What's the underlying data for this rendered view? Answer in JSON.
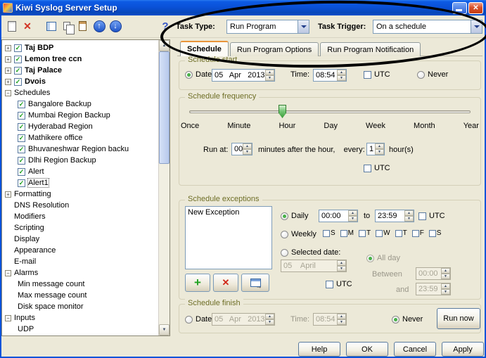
{
  "window": {
    "title": "Kiwi Syslog Server Setup"
  },
  "toolbar": {
    "task_type_label": "Task Type:",
    "task_type_value": "Run Program",
    "task_trigger_label": "Task Trigger:",
    "task_trigger_value": "On a schedule"
  },
  "tabs": [
    {
      "label": "Schedule",
      "active": true
    },
    {
      "label": "Run Program Options",
      "active": false
    },
    {
      "label": "Run Program Notification",
      "active": false
    }
  ],
  "tree": {
    "items": [
      {
        "label": "Taj BDP",
        "level": 0,
        "expander": "plus",
        "checkbox": true,
        "checked": true,
        "bold": true
      },
      {
        "label": "Lemon tree ccn",
        "level": 0,
        "expander": "plus",
        "checkbox": true,
        "checked": true,
        "bold": true
      },
      {
        "label": "Taj Palace",
        "level": 0,
        "expander": "plus",
        "checkbox": true,
        "checked": true,
        "bold": true
      },
      {
        "label": "Dvois",
        "level": 0,
        "expander": "plus",
        "checkbox": true,
        "checked": true,
        "bold": true
      },
      {
        "label": "Schedules",
        "level": 0,
        "expander": "minus"
      },
      {
        "label": "Bangalore Backup",
        "level": 1,
        "checkbox": true,
        "checked": true
      },
      {
        "label": "Mumbai Region Backup",
        "level": 1,
        "checkbox": true,
        "checked": true
      },
      {
        "label": "Hyderabad Region",
        "level": 1,
        "checkbox": true,
        "checked": true
      },
      {
        "label": "Mathikere office",
        "level": 1,
        "checkbox": true,
        "checked": true
      },
      {
        "label": "Bhuvaneshwar Region backu",
        "level": 1,
        "checkbox": true,
        "checked": true
      },
      {
        "label": "Dlhi Region Backup",
        "level": 1,
        "checkbox": true,
        "checked": true
      },
      {
        "label": "Alert",
        "level": 1,
        "checkbox": true,
        "checked": true
      },
      {
        "label": "Alert1",
        "level": 1,
        "checkbox": true,
        "checked": true,
        "selected": true
      },
      {
        "label": "Formatting",
        "level": 0,
        "expander": "plus"
      },
      {
        "label": "DNS Resolution",
        "level": 0
      },
      {
        "label": "Modifiers",
        "level": 0
      },
      {
        "label": "Scripting",
        "level": 0
      },
      {
        "label": "Display",
        "level": 0
      },
      {
        "label": "Appearance",
        "level": 0
      },
      {
        "label": "E-mail",
        "level": 0
      },
      {
        "label": "Alarms",
        "level": 0,
        "expander": "minus"
      },
      {
        "label": "Min message count",
        "level": 1
      },
      {
        "label": "Max message count",
        "level": 1
      },
      {
        "label": "Disk space monitor",
        "level": 1
      },
      {
        "label": "Inputs",
        "level": 0,
        "expander": "minus"
      },
      {
        "label": "UDP",
        "level": 1
      }
    ]
  },
  "schedule_start": {
    "title": "Schedule start",
    "date_label": "Date:",
    "date_value": "05   Apr   2013",
    "time_label": "Time:",
    "time_value": "08:54",
    "utc_label": "UTC",
    "never_label": "Never"
  },
  "schedule_frequency": {
    "title": "Schedule frequency",
    "slider_labels": [
      "Once",
      "Minute",
      "Hour",
      "Day",
      "Week",
      "Month",
      "Year"
    ],
    "slider_position": "Hour",
    "run_at_label": "Run at:",
    "run_at_value": "00",
    "after_label": "minutes after the hour,    every:",
    "every_value": "1",
    "unit_label": "hour(s)",
    "utc_label": "UTC"
  },
  "schedule_exceptions": {
    "title": "Schedule exceptions",
    "list_items": [
      "New Exception"
    ],
    "daily_label": "Daily",
    "daily_from": "00:00",
    "to_label": "to",
    "daily_to": "23:59",
    "utc_label": "UTC",
    "weekly_label": "Weekly",
    "week_days": [
      "S",
      "M",
      "T",
      "W",
      "T",
      "F",
      "S"
    ],
    "selected_date_label": "Selected date:",
    "selected_date_value": "05    April",
    "all_day_label": "All day",
    "between_label": "Between",
    "between_from": "00:00",
    "and_label": "and",
    "between_to": "23:59",
    "utc2_label": "UTC"
  },
  "schedule_finish": {
    "title": "Schedule finish",
    "date_label": "Date:",
    "date_value": "05   Apr   2013",
    "time_label": "Time:",
    "time_value": "08:54",
    "never_label": "Never",
    "run_now_label": "Run now"
  },
  "footer_buttons": [
    "Help",
    "OK",
    "Cancel",
    "Apply"
  ],
  "icons": {
    "close": "✕",
    "delete": "✕",
    "move_up": "↑",
    "move_down": "↓",
    "help": "?",
    "add": "+",
    "remove": "✕",
    "check": "✓",
    "spin_up": "▲",
    "spin_down": "▼",
    "scroll_up": "▲",
    "scroll_down": "▼"
  }
}
